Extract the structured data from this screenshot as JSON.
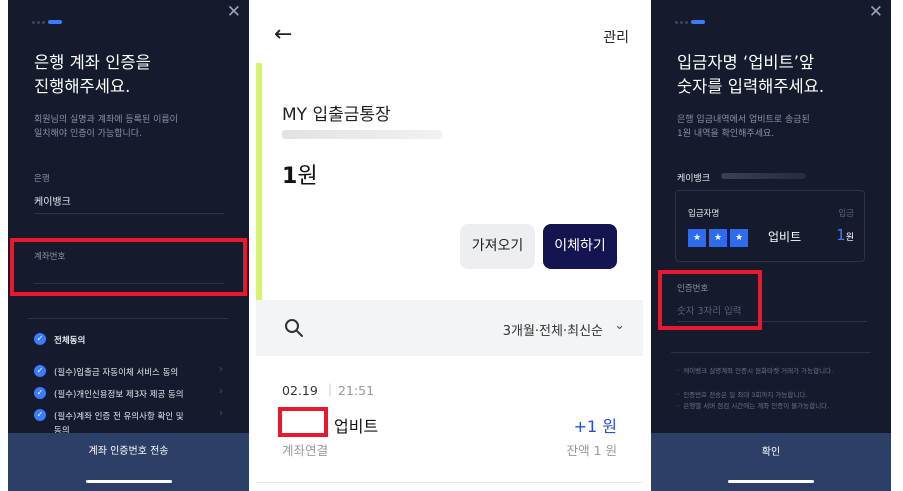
{
  "left_panel": {
    "title_line1": "은행 계좌 인증을",
    "title_line2": "진행해주세요.",
    "subtitle_line1": "회원님의 실명과 계좌에 등록된 이름이",
    "subtitle_line2": "일치해야 인증이 가능합니다.",
    "bank_label": "은행",
    "bank_value": "케이뱅크",
    "account_label": "계좌번호",
    "agree_all": "전체동의",
    "agreements": [
      "(필수)입출금 자동이체 서비스 동의",
      "(필수)개인신용정보 제3자 제공 동의",
      "(필수)계좌 인증 전 유의사항 확인 및",
      "동의"
    ],
    "submit_label": "계좌 인증번호 전송"
  },
  "center_panel": {
    "manage_label": "관리",
    "account_name": "MY 입출금통장",
    "balance_number": "1",
    "balance_unit": "원",
    "btn_fetch": "가져오기",
    "btn_transfer": "이체하기",
    "filter_label": "3개월·전체·최신순",
    "transaction": {
      "date": "02.19",
      "time": "21:51",
      "name": "업비트",
      "amount": "+1 원",
      "type": "계좌연결",
      "balance": "잔액 1 원"
    }
  },
  "right_panel": {
    "title_line1": "입금자명 ‘업비트’앞",
    "title_line2": "숫자를 입력해주세요.",
    "subtitle_line1": "은행 입금내역에서 업비트로 송금된",
    "subtitle_line2": "1원 내역을 확인해주세요.",
    "bank_label": "케이뱅크",
    "card_col1": "입금자명",
    "card_col2": "입금",
    "card_name": "업비트",
    "card_amount_num": "1",
    "card_amount_unit": "원",
    "star_glyph": "★",
    "code_label": "인증번호",
    "code_placeholder": "숫자 3자리 입력",
    "notes": [
      "케이뱅크 실명계좌 인증시 원화마켓 거래가 가능합니다.",
      "인증번호 전송은 일 최대 3회까지 가능합니다.",
      "은행별 서버 점검 시간에는 계좌 인증이 불가능합니다."
    ],
    "confirm_label": "확인"
  },
  "colors": {
    "panel_bg": "#151a2c",
    "accent_blue": "#3b7cff",
    "highlight_red": "#e8192c",
    "transfer_btn": "#141550",
    "account_bar": "#d9f26b",
    "amount_blue": "#2450d8"
  },
  "icons": {
    "close": "close-icon",
    "back": "back-arrow-icon",
    "search": "search-icon",
    "chevron": "chevron-down-icon",
    "check": "check-circle-icon"
  }
}
